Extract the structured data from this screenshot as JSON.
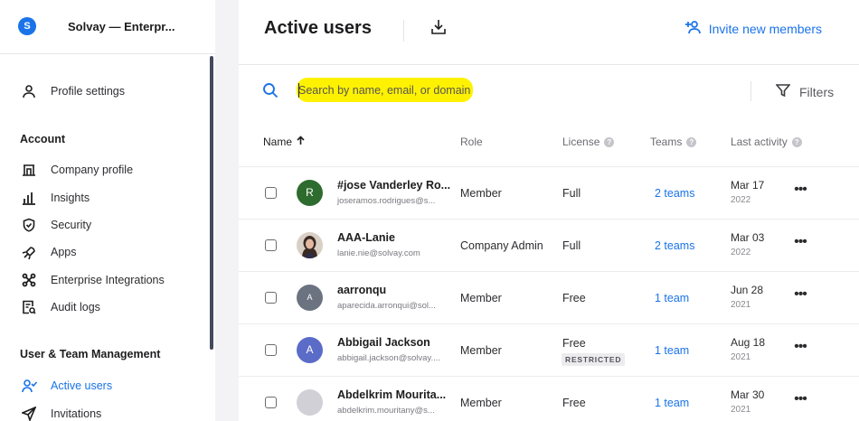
{
  "sidebar": {
    "org_logo_letter": "S",
    "org_name": "Solvay — Enterpr...",
    "profile_label": "Profile settings",
    "account_heading": "Account",
    "account_items": [
      {
        "label": "Company profile",
        "icon": "building-icon"
      },
      {
        "label": "Insights",
        "icon": "bar-chart-icon"
      },
      {
        "label": "Security",
        "icon": "shield-icon"
      },
      {
        "label": "Apps",
        "icon": "apps-icon"
      },
      {
        "label": "Enterprise Integrations",
        "icon": "integrations-icon"
      },
      {
        "label": "Audit logs",
        "icon": "audit-log-icon"
      }
    ],
    "mgmt_heading": "User & Team Management",
    "mgmt_items": [
      {
        "label": "Active users",
        "icon": "user-check-icon",
        "active": true
      },
      {
        "label": "Invitations",
        "icon": "send-icon"
      }
    ]
  },
  "header": {
    "title": "Active users",
    "invite_label": "Invite new members"
  },
  "search": {
    "placeholder": "Search by name, email, or domain",
    "value": ""
  },
  "filters_label": "Filters",
  "columns": {
    "name": "Name",
    "role": "Role",
    "license": "License",
    "teams": "Teams",
    "last_activity": "Last activity"
  },
  "users": [
    {
      "name": "#jose Vanderley Ro...",
      "email": "joseramos.rodrigues@s...",
      "initial": "R",
      "avatar_color": "#2e6b2e",
      "role": "Member",
      "license": "Full",
      "restricted": "",
      "teams": "2 teams",
      "date": "Mar 17",
      "year": "2022"
    },
    {
      "name": "AAA-Lanie",
      "email": "lanie.nie@solvay.com",
      "initial": "",
      "avatar_color": "#3a2a24",
      "role": "Company Admin",
      "license": "Full",
      "restricted": "",
      "teams": "2 teams",
      "date": "Mar 03",
      "year": "2022"
    },
    {
      "name": "aarronqu",
      "email": "aparecida.arronqui@sol...",
      "initial": "A",
      "avatar_color": "#6b7280",
      "role": "Member",
      "license": "Free",
      "restricted": "",
      "teams": "1 team",
      "date": "Jun 28",
      "year": "2021"
    },
    {
      "name": "Abbigail Jackson",
      "email": "abbigail.jackson@solvay....",
      "initial": "A",
      "avatar_color": "#5b6bc8",
      "role": "Member",
      "license": "Free",
      "restricted": "RESTRICTED",
      "teams": "1 team",
      "date": "Aug 18",
      "year": "2021"
    },
    {
      "name": "Abdelkrim Mourita...",
      "email": "abdelkrim.mouritany@s...",
      "initial": "",
      "avatar_color": "#d0d0d6",
      "role": "Member",
      "license": "Free",
      "restricted": "",
      "teams": "1 team",
      "date": "Mar 30",
      "year": "2021"
    }
  ],
  "colors": {
    "accent": "#1a73e8",
    "search_highlight": "#fff200"
  }
}
